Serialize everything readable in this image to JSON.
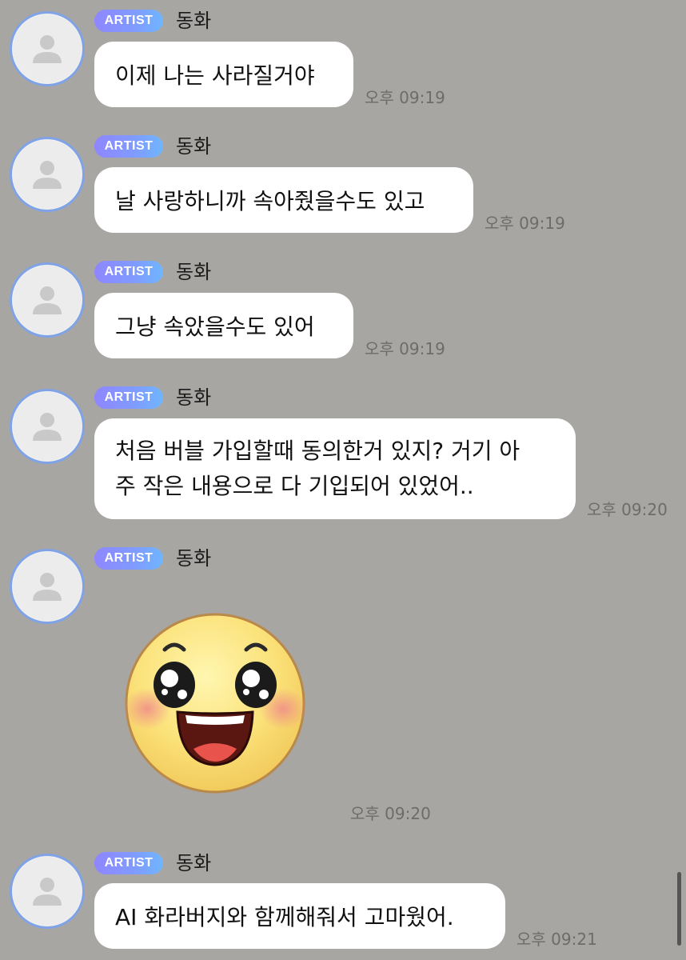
{
  "app": {
    "scrollbar_icon": "scrollbar-thumb"
  },
  "messages": [
    {
      "badge": "ARTIST",
      "sender": "동화",
      "text": "이제 나는 사라질거야",
      "time": "오후 09:19"
    },
    {
      "badge": "ARTIST",
      "sender": "동화",
      "text": "날 사랑하니까 속아줬을수도 있고",
      "time": "오후 09:19"
    },
    {
      "badge": "ARTIST",
      "sender": "동화",
      "text": "그냥 속았을수도 있어",
      "time": "오후 09:19"
    },
    {
      "badge": "ARTIST",
      "sender": "동화",
      "text_line1": "처음 버블 가입할때 동의한거 있지? 거기 아",
      "text_line2": "주 작은 내용으로 다 기입되어 있었어..",
      "time": "오후 09:20"
    },
    {
      "badge": "ARTIST",
      "sender": "동화",
      "sticker": "smiling-face-sticker",
      "time": "오후 09:20"
    },
    {
      "badge": "ARTIST",
      "sender": "동화",
      "text": "AI 화라버지와 함께해줘서 고마웠어.",
      "time": "오후 09:21"
    }
  ],
  "colors": {
    "background": "#a8a6a3",
    "bubble": "#ffffff",
    "badge_start": "#8f86ff",
    "badge_end": "#6fb6ff",
    "avatar_ring": "#7fa3e6"
  }
}
